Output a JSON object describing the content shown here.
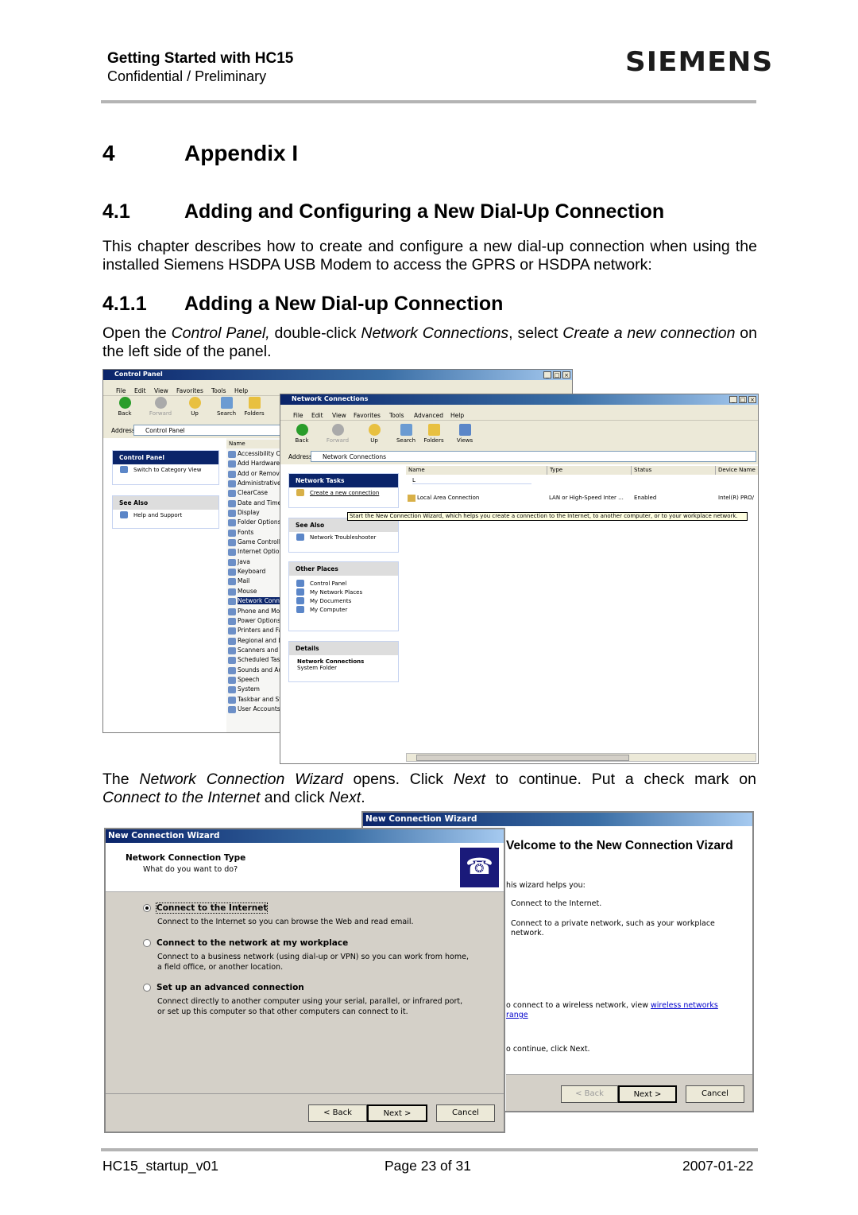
{
  "header": {
    "title": "Getting Started with HC15",
    "subtitle": "Confidential / Preliminary",
    "logo": "SIEMENS"
  },
  "section": {
    "number": "4",
    "title": "Appendix I"
  },
  "subsection": {
    "number": "4.1",
    "title": "Adding and Configuring a New Dial-Up Connection",
    "intro": "This chapter describes how to create and configure a new dial-up connection when using the installed Siemens HSDPA USB Modem to access the GPRS or HSDPA network:"
  },
  "subsubsection": {
    "number": "4.1.1",
    "title": "Adding a New Dial-up Connection"
  },
  "para1": {
    "t1": "Open the ",
    "i1": "Control Panel,",
    "t2": " double-click ",
    "i2": "Network Connections",
    "t3": ", select ",
    "i3": "Create a new connection",
    "t4": " on the left side of the panel."
  },
  "para2": {
    "t1": "The ",
    "i1": "Network Connection Wizard",
    "t2": " opens. Click ",
    "i2": "Next",
    "t3": " to continue. Put a check mark on ",
    "i3": "Connect to the Internet",
    "t4": " and click ",
    "i4": "Next",
    "t5": "."
  },
  "control_panel": {
    "title": "Control Panel",
    "menu": [
      "File",
      "Edit",
      "View",
      "Favorites",
      "Tools",
      "Help"
    ],
    "toolbar": [
      "Back",
      "Forward",
      "Up",
      "Search",
      "Folders"
    ],
    "address_label": "Address",
    "address": "Control Panel",
    "task_title": "Control Panel",
    "task_item": "Switch to Category View",
    "see_also": "See Also",
    "see_also_item": "Help and Support",
    "column": "Name",
    "items": [
      "Accessibility Op",
      "Add Hardware",
      "Add or Remove",
      "Administrative",
      "ClearCase",
      "Date and Time",
      "Display",
      "Folder Options",
      "Fonts",
      "Game Controlle",
      "Internet Optior",
      "Java",
      "Keyboard",
      "Mail",
      "Mouse",
      "Network Conne",
      "Phone and Moc",
      "Power Options",
      "Printers and Fa",
      "Regional and L",
      "Scanners and C",
      "Scheduled Tasl",
      "Sounds and Au",
      "Speech",
      "System",
      "Taskbar and St",
      "User Accounts"
    ],
    "selected": "Network Conne"
  },
  "network_connections": {
    "title": "Network Connections",
    "menu": [
      "File",
      "Edit",
      "View",
      "Favorites",
      "Tools",
      "Advanced",
      "Help"
    ],
    "toolbar": [
      "Back",
      "Forward",
      "Up",
      "Search",
      "Folders",
      "Views"
    ],
    "address_label": "Address",
    "address": "Network Connections",
    "columns": [
      "Name",
      "Type",
      "Status",
      "Device Name"
    ],
    "group": "L",
    "row": {
      "name": "Local Area Connection",
      "type": "LAN or High-Speed Inter ...",
      "status": "Enabled",
      "device": "Intel(R) PRO/"
    },
    "tooltip": "Start the New Connection Wizard, which helps you create a connection to the Internet, to another computer, or to your workplace network.",
    "tasks": {
      "title": "Network Tasks",
      "item": "Create a new connection"
    },
    "see_also": {
      "title": "See Also",
      "item": "Network Troubleshooter"
    },
    "other_places": {
      "title": "Other Places",
      "items": [
        "Control Panel",
        "My Network Places",
        "My Documents",
        "My Computer"
      ]
    },
    "details": {
      "title": "Details",
      "name": "Network Connections",
      "type": "System Folder"
    }
  },
  "wizard_welcome": {
    "title": "New Connection Wizard",
    "heading": "Velcome to the New Connection Vizard",
    "intro": "his wizard helps you:",
    "b1": "Connect to the Internet.",
    "b2": "Connect to a private network, such as your workplace network.",
    "wireless": "o connect to a wireless network, view ",
    "wireless_link": "wireless networks",
    "wireless_link2": "range",
    "cont": "o continue, click Next.",
    "back": "< Back",
    "next": "Next >",
    "cancel": "Cancel"
  },
  "wizard_type": {
    "title": "New Connection Wizard",
    "heading": "Network Connection Type",
    "subheading": "What do you want to do?",
    "options": [
      {
        "label": "Connect to the Internet",
        "desc": "Connect to the Internet so you can browse the Web and read email.",
        "selected": true
      },
      {
        "label": "Connect to the network at my workplace",
        "desc": "Connect to a business network (using dial-up or VPN) so you can work from home, a field office, or another location.",
        "selected": false
      },
      {
        "label": "Set up an advanced connection",
        "desc": "Connect directly to another computer using your serial, parallel, or infrared port, or set up this computer so that other computers can connect to it.",
        "selected": false
      }
    ],
    "back": "< Back",
    "next": "Next >",
    "cancel": "Cancel"
  },
  "footer": {
    "doc": "HC15_startup_v01",
    "page": "Page 23 of 31",
    "date": "2007-01-22"
  }
}
